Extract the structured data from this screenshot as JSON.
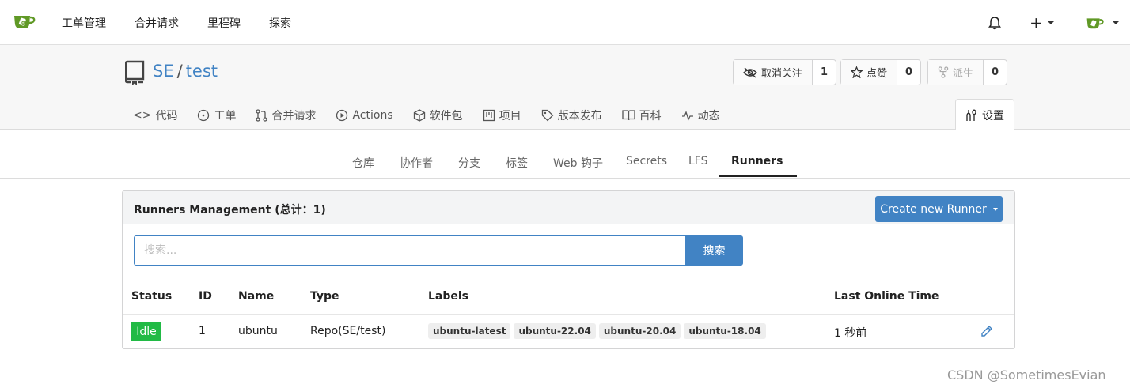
{
  "nav": {
    "items": [
      "工单管理",
      "合并请求",
      "里程碑",
      "探索"
    ]
  },
  "repo": {
    "owner": "SE",
    "slash": "/",
    "name": "test",
    "watch": {
      "label": "取消关注",
      "count": "1"
    },
    "star": {
      "label": "点赞",
      "count": "0"
    },
    "fork": {
      "label": "派生",
      "count": "0"
    },
    "tabs": [
      {
        "icon": "code-icon",
        "label": "代码"
      },
      {
        "icon": "issue-icon",
        "label": "工单"
      },
      {
        "icon": "pull-request-icon",
        "label": "合并请求"
      },
      {
        "icon": "play-icon",
        "label": "Actions"
      },
      {
        "icon": "package-icon",
        "label": "软件包"
      },
      {
        "icon": "project-icon",
        "label": "项目"
      },
      {
        "icon": "tag-icon",
        "label": "版本发布"
      },
      {
        "icon": "book-icon",
        "label": "百科"
      },
      {
        "icon": "pulse-icon",
        "label": "动态"
      }
    ],
    "settings_label": "设置"
  },
  "subtabs": [
    "仓库",
    "协作者",
    "分支",
    "标签",
    "Web 钩子",
    "Secrets",
    "LFS",
    "Runners"
  ],
  "panel": {
    "title": "Runners Management (总计：1)",
    "create_button": "Create new Runner",
    "search_placeholder": "搜索...",
    "search_button": "搜索",
    "columns": [
      "Status",
      "ID",
      "Name",
      "Type",
      "Labels",
      "Last Online Time"
    ],
    "rows": [
      {
        "status": "Idle",
        "id": "1",
        "name": "ubuntu",
        "type": "Repo(SE/test)",
        "labels": [
          "ubuntu-latest",
          "ubuntu-22.04",
          "ubuntu-20.04",
          "ubuntu-18.04"
        ],
        "last_online": "1 秒前"
      }
    ]
  },
  "watermark": "CSDN @SometimesEvian",
  "colors": {
    "accent": "#4183c4",
    "idle": "#21ba45",
    "logo": "#609926"
  }
}
